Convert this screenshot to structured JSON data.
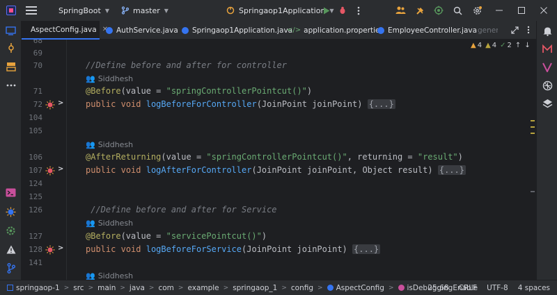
{
  "titlebar": {
    "project": "SpringBoot",
    "branch": "master",
    "run_config": "Springaop1Application"
  },
  "tabs": [
    {
      "label": "AspectConfig.java",
      "active": true,
      "icon_color": "#3574f0"
    },
    {
      "label": "AuthService.java",
      "active": false,
      "icon_color": "#3574f0"
    },
    {
      "label": "Springaop1Application.java",
      "active": false,
      "icon_color": "#3574f0"
    },
    {
      "label": "application.properties",
      "active": false,
      "icon_color": "#6aab73"
    },
    {
      "label": "EmployeeController.java",
      "active": false,
      "icon_color": "#3574f0"
    },
    {
      "label": "genera",
      "active": false,
      "icon_color": "#3574f0"
    }
  ],
  "inspections": {
    "warnings": "4",
    "weak_warnings": "4",
    "typos": "2"
  },
  "editor": {
    "line_numbers": [
      "68",
      "69",
      "70",
      "71",
      "72",
      "104",
      "105",
      "106",
      "107",
      "124",
      "125",
      "126",
      "127",
      "128",
      "141"
    ],
    "author": "Siddhesh",
    "code": {
      "comment_controller": "//Define before and after for controller",
      "ann_before_1": "@Before",
      "before_1_args_open": "(value = ",
      "before_1_value": "\"springControllerPointcut()\"",
      "before_1_close": ")",
      "kw_public": "public",
      "kw_void": "void",
      "fn_before_controller": "logBeforeForController",
      "param_joinpoint_type": "JoinPoint",
      "param_joinpoint_name": "joinPoint",
      "paren_open": "(",
      "paren_close": ")",
      "fold": "{...}",
      "ann_after_returning": "@AfterReturning",
      "ar_value_key": "(value = ",
      "ar_value": "\"springControllerPointcut()\"",
      "ar_returning_key": ", returning = ",
      "ar_returning_value": "\"result\"",
      "fn_after_controller": "logAfterForController",
      "comma": ", ",
      "param_object_type": "Object",
      "param_result_name": "result",
      "comment_service": " //Define before and after for Service",
      "before_2_value": "\"servicePointcut()\"",
      "fn_before_service": "logBeforeForService"
    }
  },
  "statusbar": {
    "breadcrumbs": [
      "springaop-1",
      "src",
      "main",
      "java",
      "com",
      "example",
      "springaop_1",
      "config",
      "AspectConfig",
      "isDebuggingEnable"
    ],
    "position": "25:68",
    "line_sep": "CRLF",
    "encoding": "UTF-8",
    "indent": "4 spaces"
  },
  "colors": {
    "accent": "#3574f0",
    "warning": "#e8a33d",
    "bg": "#1e1f22",
    "panel": "#2b2d30"
  }
}
